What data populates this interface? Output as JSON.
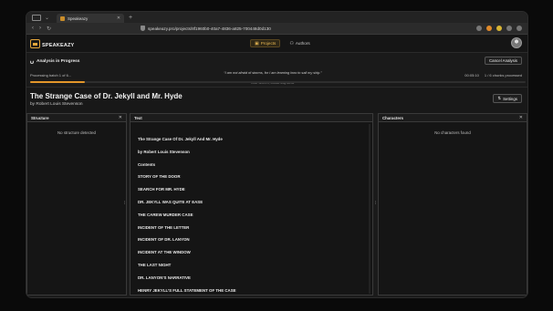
{
  "browser": {
    "tab_title": "Speakeazy",
    "url": "speakeazy.pro/projects/8f1960b0-40a7-4836-a825-700448d0d130"
  },
  "app": {
    "logo_text": "SPEAKEAZY",
    "nav": [
      {
        "label": "Projects",
        "icon": "folder-icon",
        "active": true
      },
      {
        "label": "Authors",
        "icon": "users-icon",
        "active": false
      }
    ]
  },
  "analysis": {
    "title": "Analysis in Progress",
    "cancel_label": "Cancel Analysis",
    "status": "Processing batch 1 of 6...",
    "quote": "“I am not afraid of storms, for I am learning how to sail my ship.”",
    "quote_source": "Little Women, Louisa May Alcott",
    "eta": "00:05:10",
    "chunks": "1 / 6 chunks processed",
    "progress_fraction": 0.11
  },
  "book": {
    "title": "The Strange Case of Dr. Jekyll and Mr. Hyde",
    "author": "by Robert Louis Stevenson",
    "settings_label": "Settings"
  },
  "panes": {
    "structure": {
      "title": "Structure",
      "empty": "No structure detected"
    },
    "text": {
      "title": "Text",
      "lines": [
        "The Strange Case Of Dr. Jekyll And Mr. Hyde",
        "by Robert Louis Stevenson",
        "Contents",
        "STORY OF THE DOOR",
        "SEARCH FOR MR. HYDE",
        "DR. JEKYLL WAS QUITE AT EASE",
        "THE CAREW MURDER CASE",
        "INCIDENT OF THE LETTER",
        "INCIDENT OF DR. LANYON",
        "INCIDENT AT THE WINDOW",
        "THE LAST NIGHT",
        "DR. LANYON’S NARRATIVE",
        "HENRY JEKYLL’S FULL STATEMENT OF THE CASE"
      ]
    },
    "characters": {
      "title": "Characters",
      "empty": "No characters found"
    }
  }
}
